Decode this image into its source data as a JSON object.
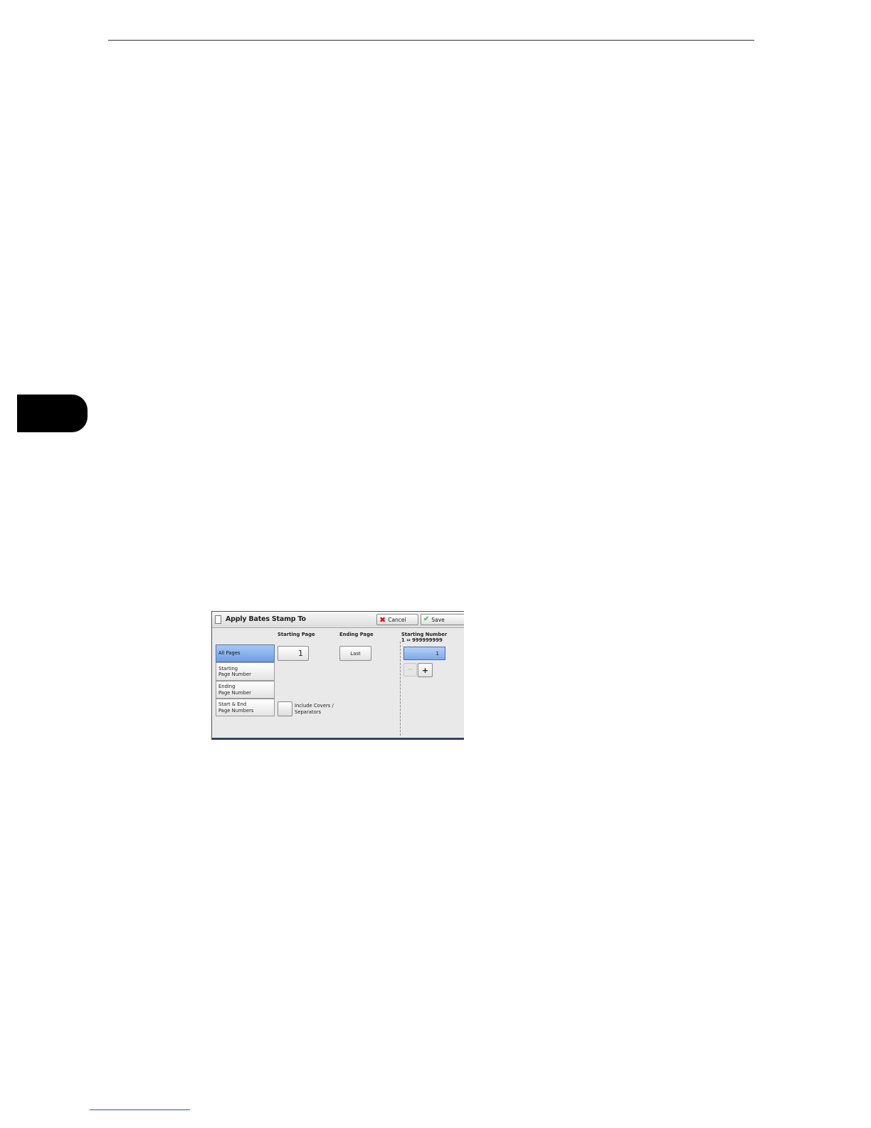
{
  "dialog": {
    "title": "Apply Bates Stamp To",
    "cancel_label": "Cancel",
    "save_label": "Save",
    "columns": {
      "starting_page": "Starting Page",
      "ending_page": "Ending Page",
      "starting_number": "Starting Number",
      "starting_number_range": "1 ⇔ 999999999"
    },
    "options": [
      {
        "line1": "All Pages",
        "line2": ""
      },
      {
        "line1": "Starting",
        "line2": "Page Number"
      },
      {
        "line1": "Ending",
        "line2": "Page Number"
      },
      {
        "line1": "Start & End",
        "line2": "Page Numbers"
      }
    ],
    "selected_option": "All Pages",
    "starting_page_value": "1",
    "ending_page_value": "Last",
    "include_covers_line1": "Include Covers /",
    "include_covers_line2": "Separators",
    "starting_number_value": "1",
    "minus_label": "−",
    "plus_label": "+"
  },
  "colors": {
    "selected": "#7fa9ea",
    "cancel_icon": "#dd1111",
    "save_icon": "#3aa84a"
  }
}
